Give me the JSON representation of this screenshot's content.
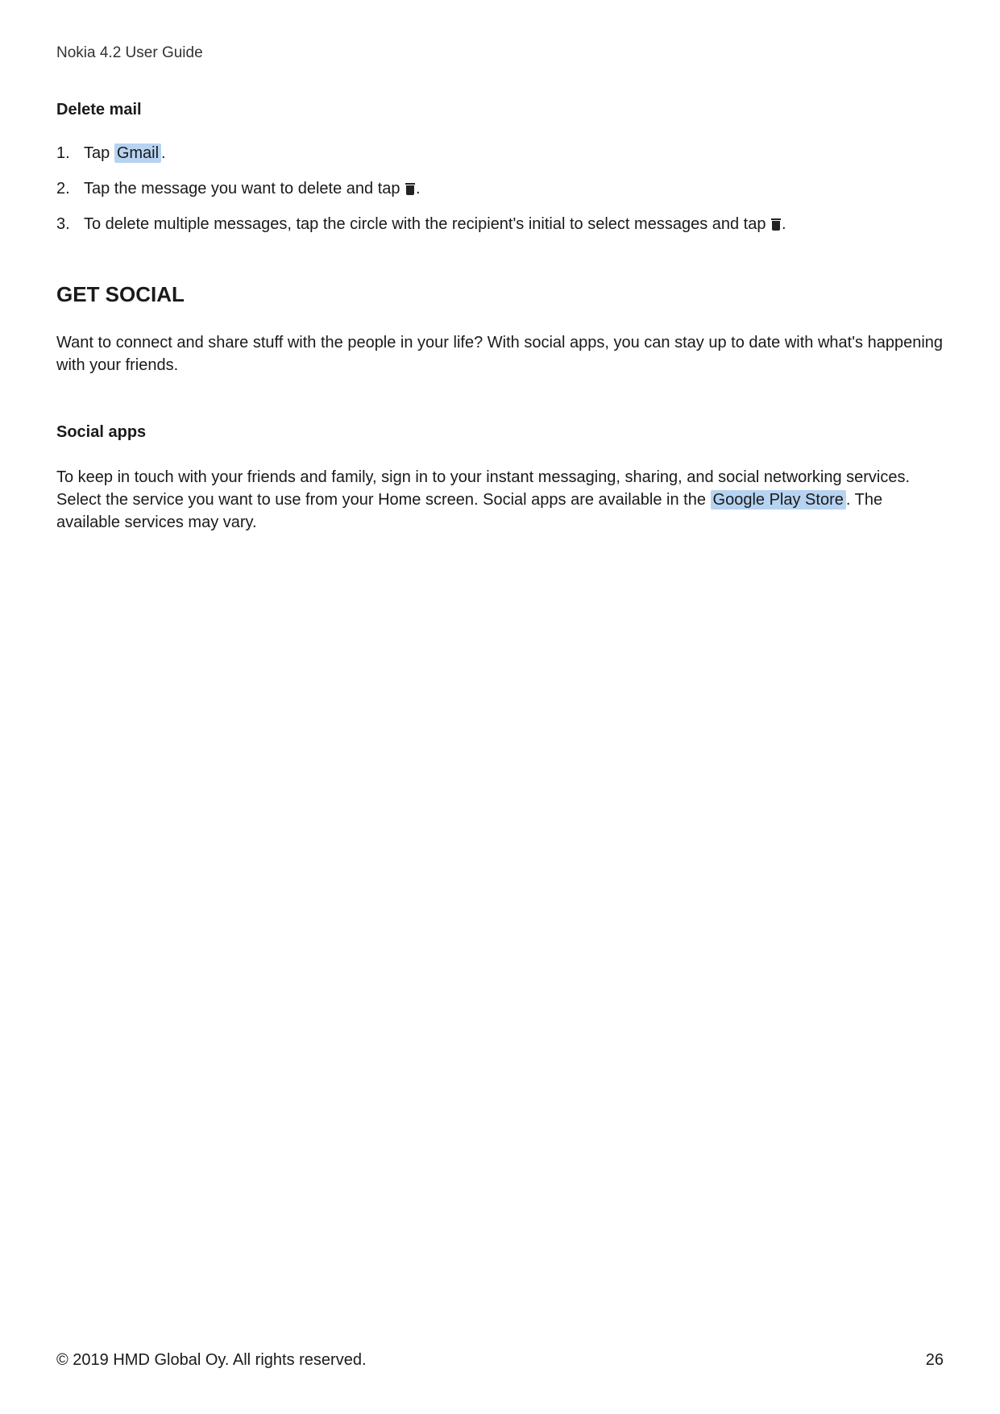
{
  "header": {
    "title": "Nokia 4.2 User Guide"
  },
  "deleteMail": {
    "heading": "Delete mail",
    "steps": {
      "s1_pre": "Tap ",
      "s1_app": "Gmail",
      "s1_post": ".",
      "s2_pre": "Tap the message you want to delete and tap ",
      "s2_post": ".",
      "s3_pre": "To delete multiple messages, tap the circle with the recipient's initial to select messages and tap ",
      "s3_post": "."
    }
  },
  "getSocial": {
    "heading": "GET SOCIAL",
    "intro": "Want to connect and share stuff with the people in your life? With social apps, you can stay up to date with what's happening with your friends.",
    "socialApps": {
      "heading": "Social apps",
      "p_pre": "To keep in touch with your friends and family, sign in to your instant messaging, sharing, and social networking services. Select the service you want to use from your Home screen. Social apps are available in the ",
      "p_app": "Google Play Store",
      "p_post": ". The available services may vary."
    }
  },
  "footer": {
    "copyright": "© 2019 HMD Global Oy. All rights reserved.",
    "page": "26"
  }
}
